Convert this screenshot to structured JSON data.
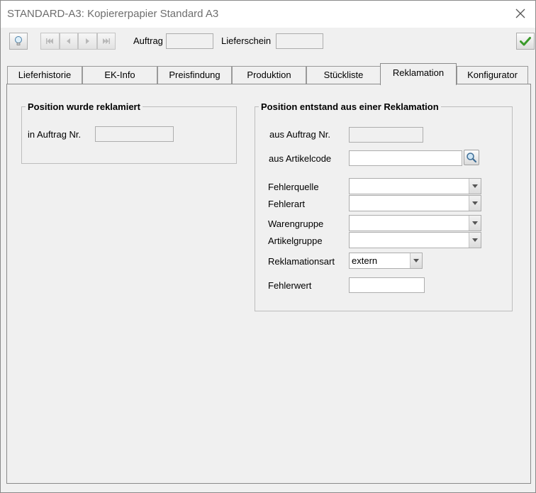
{
  "window": {
    "title": "STANDARD-A3: Kopiererpapier Standard A3",
    "close_icon": "close-icon"
  },
  "toolbar": {
    "auftrag_label": "Auftrag",
    "auftrag_value": "",
    "lieferschein_label": "Lieferschein",
    "lieferschein_value": "",
    "icons": [
      "lightbulb-icon",
      "first-icon",
      "previous-icon",
      "next-icon",
      "last-icon",
      "checkmark-icon"
    ],
    "accent_color": "#3a9a2a"
  },
  "tabs": [
    {
      "label": "Lieferhistorie"
    },
    {
      "label": "EK-Info"
    },
    {
      "label": "Preisfindung"
    },
    {
      "label": "Produktion"
    },
    {
      "label": "Stückliste"
    },
    {
      "label": "Reklamation",
      "active": true
    },
    {
      "label": "Konfigurator"
    }
  ],
  "left_group": {
    "title": "Position wurde reklamiert",
    "auftrag_nr_label": "in Auftrag Nr.",
    "auftrag_nr_value": ""
  },
  "right_group": {
    "title": "Position entstand aus einer Reklamation",
    "aus_auftrag_label": "aus Auftrag Nr.",
    "aus_auftrag_value": "",
    "aus_artikelcode_label": "aus Artikelcode",
    "aus_artikelcode_value": "",
    "fehlerquelle_label": "Fehlerquelle",
    "fehlerquelle_value": "",
    "fehlerart_label": "Fehlerart",
    "fehlerart_value": "",
    "warengruppe_label": "Warengruppe",
    "warengruppe_value": "",
    "artikelgruppe_label": "Artikelgruppe",
    "artikelgruppe_value": "",
    "reklamationsart_label": "Reklamationsart",
    "reklamationsart_value": "extern",
    "fehlerwert_label": "Fehlerwert",
    "fehlerwert_value": ""
  }
}
